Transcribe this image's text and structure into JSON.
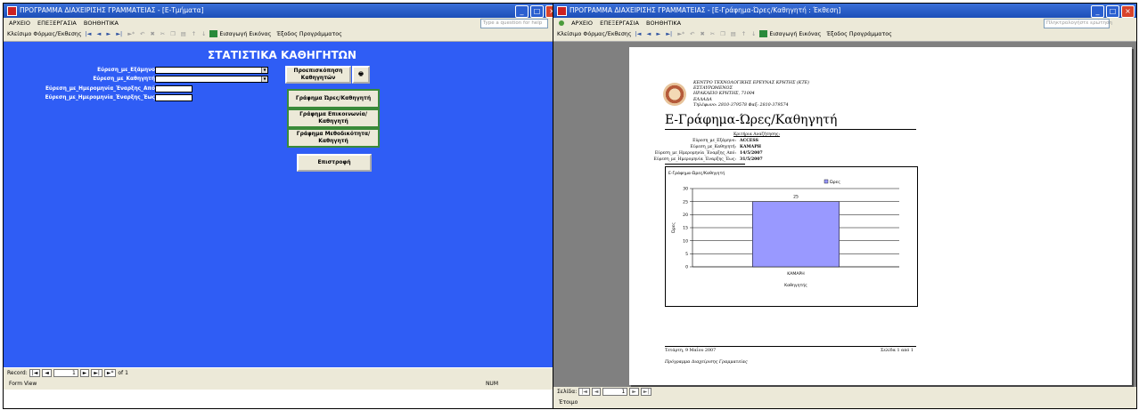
{
  "left": {
    "title": "ΠΡΟΓΡΑΜΜΑ ΔΙΑΧΕΙΡΙΣΗΣ ΓΡΑΜΜΑΤΕΙΑΣ - [Ε-Τμήματα]",
    "menu": [
      "ΑΡΧΕΙΟ",
      "ΕΠΕΞΕΡΓΑΣΙΑ",
      "ΒΟΗΘΗΤΙΚΑ"
    ],
    "help_placeholder": "Type a question for help",
    "toolbar": {
      "close": "Κλείσιμο Φόρμας/Έκθεσης",
      "import_image": "Εισαγωγή Εικόνας",
      "exit": "Έξοδος Προγράμματος"
    },
    "form_title": "ΣΤΑΤΙΣΤΙΚΑ ΚΑΘΗΓΗΤΩΝ",
    "labels": {
      "semester": "Εύρεση_με_Εξάμηνο",
      "teacher": "Εύρεση_με_Καθηγητή",
      "date_from": "Εύρεση_με_Ημερομηνία_Έναρξης_Από",
      "date_to": "Εύρεση_με_Ημερομηνία_Έναρξης_Έως"
    },
    "buttons": {
      "preview": "Προεπισκόπηση Καθηγητών",
      "chart_hours": "Γράφημα Ώρες/Καθηγητή",
      "chart_contact": "Γράφημα Επικοινωνία/Καθηγητή",
      "chart_method": "Γράφημα Μεθοδικότητα/Καθηγητή",
      "back": "Επιστροφή"
    },
    "record": {
      "label": "Record:",
      "current": "1",
      "of": "of 1"
    },
    "status": {
      "view": "Form View",
      "num": "NUM"
    }
  },
  "right": {
    "title": "ΠΡΟΓΡΑΜΜΑ ΔΙΑΧΕΙΡΙΣΗΣ ΓΡΑΜΜΑΤΕΙΑΣ - [Ε-Γράφημα-Ώρες/Καθηγητή : Έκθεση]",
    "menu": [
      "ΑΡΧΕΙΟ",
      "ΕΠΕΞΕΡΓΑΣΙΑ",
      "ΒΟΗΘΗΤΙΚΑ"
    ],
    "help_placeholder": "Πληκτρολογήστε ερώτηση",
    "toolbar": {
      "close": "Κλείσιμο Φόρμας/Έκθεσης",
      "import_image": "Εισαγωγή Εικόνας",
      "exit": "Έξοδος Προγράμματος"
    },
    "org": [
      "ΚΕΝΤΡΟ ΤΕΧΝΟΛΟΓΙΚΗΣ ΕΡΕΥΝΑΣ ΚΡΗΤΗΣ (ΚΤΕ)",
      "ΕΣΤΑΥΡΩΜΕΝΟΣ",
      "ΗΡΑΚΛΕΙΟ ΚΡΗΤΗΣ, 71004",
      "ΕΛΛΑΔΑ",
      "Τηλέφωνο: 2810-379578  Φαξ: 2810-379574"
    ],
    "report_title": "Ε-Γράφημα-Ώρες/Καθηγητή",
    "criteria_header": "Κριτήρια Αναζήτησης:",
    "criteria": [
      {
        "label": "Εύρεση_με_Εξάμηνο:",
        "value": "ACCESS"
      },
      {
        "label": "Εύρεση_με_Καθηγητή:",
        "value": "ΚΑΜΑΡΗ"
      },
      {
        "label": "Εύρεση_με_Ημερομηνία_Έναρξης_Από:",
        "value": "14/5/2007"
      },
      {
        "label": "Εύρεση_με_Ημερομηνία_Έναρξης_Έως:",
        "value": "31/5/2007"
      }
    ],
    "footer_date": "Τετάρτη, 9 Μαΐου 2007",
    "footer_page": "Σελίδα 1 από 1",
    "footer_program": "Πρόγραμμα Διαχείρισης Γραμματείας",
    "nav": {
      "label": "Σελίδα:",
      "current": "1"
    },
    "status": "Έτοιμο"
  },
  "chart_data": {
    "type": "bar",
    "title": "Ε-Γράφημα-Ώρες/Καθηγητή",
    "categories": [
      "ΚΑΜΑΡΗ"
    ],
    "series": [
      {
        "name": "Ώρες",
        "values": [
          25
        ]
      }
    ],
    "xlabel": "Καθηγητής",
    "ylabel": "Ώρες",
    "ylim": [
      0,
      30
    ],
    "yticks": [
      0,
      5,
      10,
      15,
      20,
      25,
      30
    ],
    "grid": true,
    "legend": "top",
    "bar_color": "#9999ff"
  }
}
